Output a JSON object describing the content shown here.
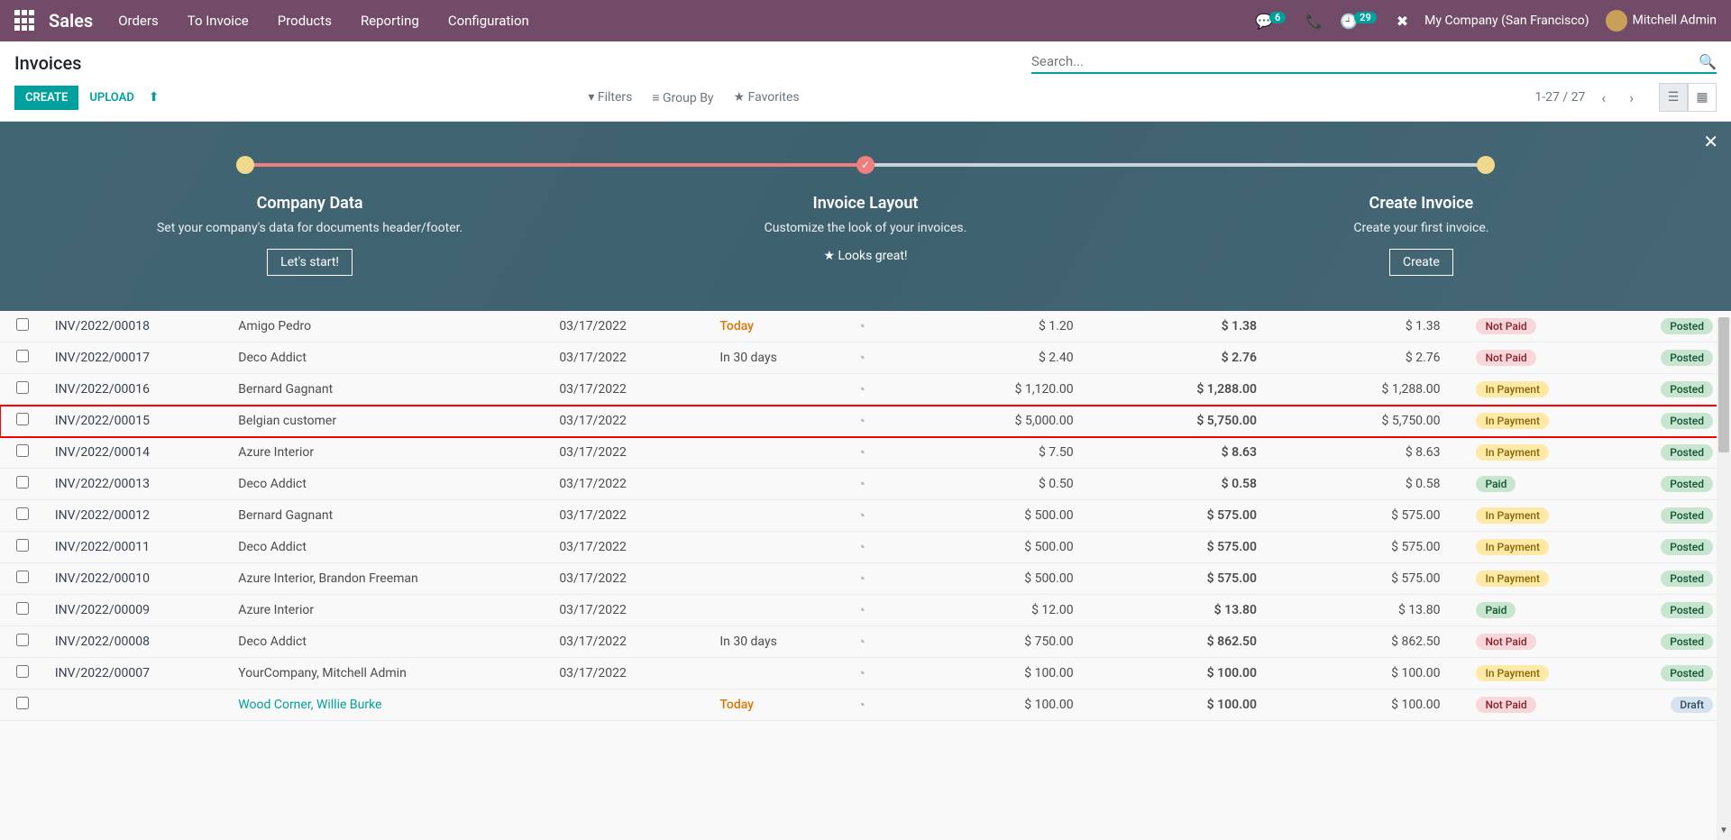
{
  "topnav": {
    "brand": "Sales",
    "menu": [
      "Orders",
      "To Invoice",
      "Products",
      "Reporting",
      "Configuration"
    ],
    "chat_badge": "6",
    "activity_badge": "29",
    "company": "My Company (San Francisco)",
    "user": "Mitchell Admin"
  },
  "controlbar": {
    "title": "Invoices",
    "create": "CREATE",
    "upload": "UPLOAD",
    "search_placeholder": "Search...",
    "filters": "Filters",
    "groupby": "Group By",
    "favorites": "Favorites",
    "pager": "1-27 / 27"
  },
  "onboarding": {
    "steps": [
      {
        "title": "Company Data",
        "desc": "Set your company's data for documents header/footer.",
        "btn": "Let's start!"
      },
      {
        "title": "Invoice Layout",
        "desc": "Customize the look of your invoices.",
        "looks": "Looks great!"
      },
      {
        "title": "Create Invoice",
        "desc": "Create your first invoice.",
        "btn": "Create"
      }
    ]
  },
  "rows": [
    {
      "num": "INV/2022/00018",
      "cust": "Amigo Pedro",
      "date": "03/17/2022",
      "due": "Today",
      "due_cls": "today",
      "untax": "$ 1.20",
      "total": "$ 1.38",
      "duea": "$ 1.38",
      "pay": "Not Paid",
      "pay_cls": "notpaid",
      "stat": "Posted",
      "stat_cls": "posted"
    },
    {
      "num": "INV/2022/00017",
      "cust": "Deco Addict",
      "date": "03/17/2022",
      "due": "In 30 days",
      "untax": "$ 2.40",
      "total": "$ 2.76",
      "duea": "$ 2.76",
      "pay": "Not Paid",
      "pay_cls": "notpaid",
      "stat": "Posted",
      "stat_cls": "posted"
    },
    {
      "num": "INV/2022/00016",
      "cust": "Bernard Gagnant",
      "date": "03/17/2022",
      "due": "",
      "untax": "$ 1,120.00",
      "total": "$ 1,288.00",
      "duea": "$ 1,288.00",
      "pay": "In Payment",
      "pay_cls": "inpayment",
      "stat": "Posted",
      "stat_cls": "posted"
    },
    {
      "num": "INV/2022/00015",
      "cust": "Belgian customer",
      "date": "03/17/2022",
      "due": "",
      "untax": "$ 5,000.00",
      "total": "$ 5,750.00",
      "duea": "$ 5,750.00",
      "pay": "In Payment",
      "pay_cls": "inpayment",
      "stat": "Posted",
      "stat_cls": "posted",
      "highlight": true
    },
    {
      "num": "INV/2022/00014",
      "cust": "Azure Interior",
      "date": "03/17/2022",
      "due": "",
      "untax": "$ 7.50",
      "total": "$ 8.63",
      "duea": "$ 8.63",
      "pay": "In Payment",
      "pay_cls": "inpayment",
      "stat": "Posted",
      "stat_cls": "posted"
    },
    {
      "num": "INV/2022/00013",
      "cust": "Deco Addict",
      "date": "03/17/2022",
      "due": "",
      "untax": "$ 0.50",
      "total": "$ 0.58",
      "duea": "$ 0.58",
      "pay": "Paid",
      "pay_cls": "paid",
      "stat": "Posted",
      "stat_cls": "posted"
    },
    {
      "num": "INV/2022/00012",
      "cust": "Bernard Gagnant",
      "date": "03/17/2022",
      "due": "",
      "untax": "$ 500.00",
      "total": "$ 575.00",
      "duea": "$ 575.00",
      "pay": "In Payment",
      "pay_cls": "inpayment",
      "stat": "Posted",
      "stat_cls": "posted"
    },
    {
      "num": "INV/2022/00011",
      "cust": "Deco Addict",
      "date": "03/17/2022",
      "due": "",
      "untax": "$ 500.00",
      "total": "$ 575.00",
      "duea": "$ 575.00",
      "pay": "In Payment",
      "pay_cls": "inpayment",
      "stat": "Posted",
      "stat_cls": "posted"
    },
    {
      "num": "INV/2022/00010",
      "cust": "Azure Interior, Brandon Freeman",
      "date": "03/17/2022",
      "due": "",
      "untax": "$ 500.00",
      "total": "$ 575.00",
      "duea": "$ 575.00",
      "pay": "In Payment",
      "pay_cls": "inpayment",
      "stat": "Posted",
      "stat_cls": "posted"
    },
    {
      "num": "INV/2022/00009",
      "cust": "Azure Interior",
      "date": "03/17/2022",
      "due": "",
      "untax": "$ 12.00",
      "total": "$ 13.80",
      "duea": "$ 13.80",
      "pay": "Paid",
      "pay_cls": "paid",
      "stat": "Posted",
      "stat_cls": "posted"
    },
    {
      "num": "INV/2022/00008",
      "cust": "Deco Addict",
      "date": "03/17/2022",
      "due": "In 30 days",
      "untax": "$ 750.00",
      "total": "$ 862.50",
      "duea": "$ 862.50",
      "pay": "Not Paid",
      "pay_cls": "notpaid",
      "stat": "Posted",
      "stat_cls": "posted"
    },
    {
      "num": "INV/2022/00007",
      "cust": "YourCompany, Mitchell Admin",
      "date": "03/17/2022",
      "due": "",
      "untax": "$ 100.00",
      "total": "$ 100.00",
      "duea": "$ 100.00",
      "pay": "In Payment",
      "pay_cls": "inpayment",
      "stat": "Posted",
      "stat_cls": "posted"
    },
    {
      "num": "",
      "cust": "Wood Corner, Willie Burke",
      "cust_link": true,
      "date": "",
      "due": "Today",
      "due_cls": "today",
      "untax": "$ 100.00",
      "total": "$ 100.00",
      "duea": "$ 100.00",
      "pay": "Not Paid",
      "pay_cls": "notpaid",
      "stat": "Draft",
      "stat_cls": "draft"
    }
  ]
}
